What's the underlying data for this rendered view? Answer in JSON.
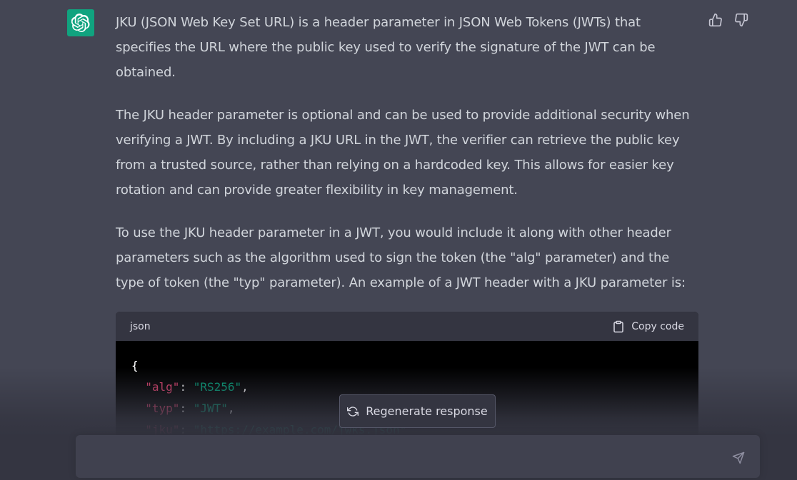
{
  "message": {
    "paragraphs": [
      "JKU (JSON Web Key Set URL) is a header parameter in JSON Web Tokens (JWTs) that specifies the URL where the public key used to verify the signature of the JWT can be obtained.",
      "The JKU header parameter is optional and can be used to provide additional security when verifying a JWT. By including a JKU URL in the JWT, the verifier can retrieve the public key from a trusted source, rather than relying on a hardcoded key. This allows for easier key rotation and can provide greater flexibility in key management.",
      "To use the JKU header parameter in a JWT, you would include it along with other header parameters such as the algorithm used to sign the token (the \"alg\" parameter) and the type of token (the \"typ\" parameter). An example of a JWT header with a JKU parameter is:"
    ]
  },
  "code_block": {
    "language": "json",
    "copy_label": "Copy code",
    "open_brace": "{",
    "lines": [
      {
        "key": "\"alg\"",
        "colon": ": ",
        "value": "\"RS256\"",
        "trail": ","
      },
      {
        "key": "\"typ\"",
        "colon": ": ",
        "value": "\"JWT\"",
        "trail": ","
      },
      {
        "key": "\"jku\"",
        "colon": ": ",
        "value": "\"https://example.com/jwks.json\"",
        "trail": ""
      }
    ]
  },
  "regenerate_label": "Regenerate response",
  "input": {
    "value": ""
  },
  "icons": {
    "avatar": "openai-logo-icon",
    "thumbs_up": "thumbs-up-icon",
    "thumbs_down": "thumbs-down-icon",
    "copy": "clipboard-icon",
    "regenerate": "refresh-icon",
    "send": "send-icon"
  },
  "colors": {
    "background": "#444654",
    "avatar": "#10a37f",
    "code_key": "#ef4473",
    "code_string": "#00a67d",
    "input_bg": "#40414f"
  }
}
